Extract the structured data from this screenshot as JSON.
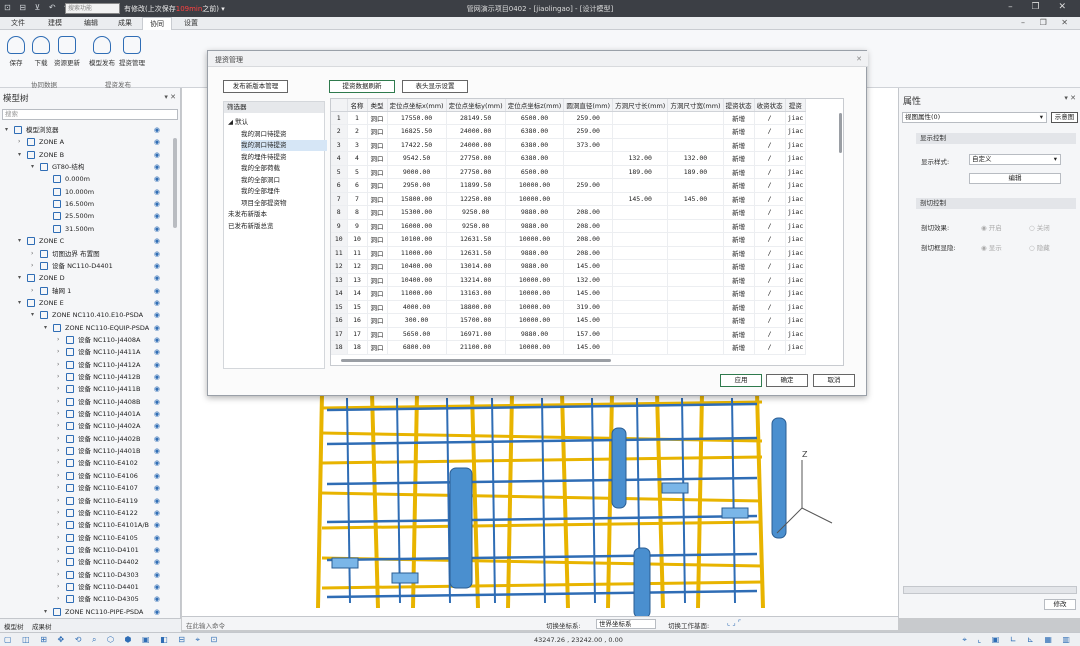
{
  "titlebar": {
    "quick_icons": "⊡ ⊟ ⊻ ↶ ↷",
    "search_placeholder": "搜索功能",
    "status_prefix": "有修改(上次保存",
    "status_highlight": "109min",
    "status_suffix": "之前)",
    "window_title": "管网演示项目0402 - [jiaolingao] - [设计模型]",
    "window_controls": "– ❐ ✕"
  },
  "menu": {
    "tabs": [
      "文件",
      "建模",
      "编辑",
      "成果",
      "协同",
      "设置"
    ],
    "active_index": 4,
    "right_controls": "– ❐ ✕"
  },
  "ribbon": {
    "buttons": [
      "保存",
      "下载",
      "资源更新",
      "模型发布",
      "提资管理"
    ],
    "groups": [
      "协同数据",
      "提资发布"
    ]
  },
  "model_tree": {
    "title": "模型树",
    "search_placeholder": "搜索",
    "rows": [
      {
        "label": "模型浏览器",
        "level": 0,
        "expanded": true,
        "icon": "folder-icon"
      },
      {
        "label": "ZONE A",
        "level": 1,
        "expanded": false,
        "icon": "folder-icon"
      },
      {
        "label": "ZONE B",
        "level": 1,
        "expanded": true,
        "icon": "folder-icon"
      },
      {
        "label": "GT80-结构",
        "level": 2,
        "expanded": true,
        "icon": "structure-icon"
      },
      {
        "label": "0.000m",
        "level": 3,
        "icon": "grid-icon"
      },
      {
        "label": "10.000m",
        "level": 3,
        "icon": "grid-icon"
      },
      {
        "label": "16.500m",
        "level": 3,
        "icon": "grid-icon"
      },
      {
        "label": "25.500m",
        "level": 3,
        "icon": "grid-icon"
      },
      {
        "label": "31.500m",
        "level": 3,
        "icon": "grid-icon"
      },
      {
        "label": "ZONE C",
        "level": 1,
        "expanded": true,
        "icon": "folder-icon"
      },
      {
        "label": "切图边界 布置图",
        "level": 2,
        "expanded": false,
        "icon": "drawing-icon"
      },
      {
        "label": "设备 NC110-D4401",
        "level": 2,
        "expanded": false,
        "icon": "equipment-icon"
      },
      {
        "label": "ZONE D",
        "level": 1,
        "expanded": true,
        "icon": "folder-icon"
      },
      {
        "label": "轴网 1",
        "level": 2,
        "expanded": false,
        "icon": "axis-icon"
      },
      {
        "label": "ZONE E",
        "level": 1,
        "expanded": true,
        "icon": "folder-icon"
      },
      {
        "label": "ZONE NC110.410.E10-PSDA",
        "level": 2,
        "expanded": true,
        "icon": "folder-icon"
      },
      {
        "label": "ZONE NC110-EQUIP-PSDA",
        "level": 3,
        "expanded": true,
        "icon": "folder-icon"
      },
      {
        "label": "设备 NC110-J4408A",
        "level": 4,
        "icon": "equipment-icon"
      },
      {
        "label": "设备 NC110-J4411A",
        "level": 4,
        "icon": "equipment-icon"
      },
      {
        "label": "设备 NC110-J4412A",
        "level": 4,
        "icon": "equipment-icon"
      },
      {
        "label": "设备 NC110-J4412B",
        "level": 4,
        "icon": "equipment-icon"
      },
      {
        "label": "设备 NC110-J4411B",
        "level": 4,
        "icon": "equipment-icon"
      },
      {
        "label": "设备 NC110-J4408B",
        "level": 4,
        "icon": "equipment-icon"
      },
      {
        "label": "设备 NC110-J4401A",
        "level": 4,
        "icon": "equipment-icon"
      },
      {
        "label": "设备 NC110-J4402A",
        "level": 4,
        "icon": "equipment-icon"
      },
      {
        "label": "设备 NC110-J4402B",
        "level": 4,
        "icon": "equipment-icon"
      },
      {
        "label": "设备 NC110-J4401B",
        "level": 4,
        "icon": "equipment-icon"
      },
      {
        "label": "设备 NC110-E4102",
        "level": 4,
        "icon": "equipment-icon"
      },
      {
        "label": "设备 NC110-E4106",
        "level": 4,
        "icon": "equipment-icon"
      },
      {
        "label": "设备 NC110-E4107",
        "level": 4,
        "icon": "equipment-icon"
      },
      {
        "label": "设备 NC110-E4119",
        "level": 4,
        "icon": "equipment-icon"
      },
      {
        "label": "设备 NC110-E4122",
        "level": 4,
        "icon": "equipment-icon"
      },
      {
        "label": "设备 NC110-E4101A/B",
        "level": 4,
        "icon": "equipment-icon"
      },
      {
        "label": "设备 NC110-E4105",
        "level": 4,
        "icon": "equipment-icon"
      },
      {
        "label": "设备 NC110-D4101",
        "level": 4,
        "icon": "equipment-icon"
      },
      {
        "label": "设备 NC110-D4402",
        "level": 4,
        "icon": "equipment-icon"
      },
      {
        "label": "设备 NC110-D4303",
        "level": 4,
        "icon": "equipment-icon"
      },
      {
        "label": "设备 NC110-D4401",
        "level": 4,
        "icon": "equipment-icon"
      },
      {
        "label": "设备 NC110-D4305",
        "level": 4,
        "icon": "equipment-icon"
      },
      {
        "label": "ZONE NC110-PIPE-PSDA",
        "level": 3,
        "expanded": true,
        "icon": "folder-icon"
      }
    ],
    "bottom_tabs": [
      "模型树",
      "成果树"
    ]
  },
  "properties": {
    "title": "属性",
    "view_select": "视图属性(0)",
    "select_button": "示意图",
    "section_display": "显示控制",
    "display_style_label": "显示样式:",
    "display_style_value": "自定义",
    "edit_button": "编辑",
    "section_cut": "剖切控制",
    "cut_effect_label": "剖切效果:",
    "cut_effect_options": [
      "开启",
      "关闭"
    ],
    "cut_hide_label": "剖切框显隐:",
    "cut_hide_options": [
      "显示",
      "隐藏"
    ],
    "modify_button": "修改"
  },
  "dialog": {
    "title": "提资管理",
    "btn_new_version": "发布新版本管理",
    "btn_refresh": "提资数据刷新",
    "btn_header_settings": "表头显示设置",
    "filter_title": "筛选器",
    "filter_items": [
      {
        "label": "默认",
        "level": 0,
        "expanded": true
      },
      {
        "label": "我的洞口待提资",
        "level": 1
      },
      {
        "label": "我的洞口待提资",
        "level": 1,
        "selected": true
      },
      {
        "label": "我的埋件待提资",
        "level": 1
      },
      {
        "label": "我的全部荷载",
        "level": 1
      },
      {
        "label": "我的全部洞口",
        "level": 1
      },
      {
        "label": "我的全部埋件",
        "level": 1
      },
      {
        "label": "项目全部提资物",
        "level": 1
      },
      {
        "label": "未发布新版本",
        "level": 0
      },
      {
        "label": "已发布新版总览",
        "level": 0
      }
    ],
    "columns": [
      "名称",
      "类型",
      "定位点坐标x(mm)",
      "定位点坐标y(mm)",
      "定位点坐标z(mm)",
      "圆洞直径(mm)",
      "方洞尺寸长(mm)",
      "方洞尺寸宽(mm)",
      "提资状态",
      "收资状态",
      "提资"
    ],
    "rows": [
      [
        "1",
        "洞口",
        "17550.00",
        "28149.50",
        "6500.00",
        "259.00",
        "",
        "",
        "新增",
        "/",
        "jiac"
      ],
      [
        "2",
        "洞口",
        "16825.50",
        "24000.00",
        "6380.00",
        "259.00",
        "",
        "",
        "新增",
        "/",
        "jiac"
      ],
      [
        "3",
        "洞口",
        "17422.50",
        "24000.00",
        "6380.00",
        "373.00",
        "",
        "",
        "新增",
        "/",
        "jiac"
      ],
      [
        "4",
        "洞口",
        "9542.50",
        "27750.00",
        "6380.00",
        "",
        "132.00",
        "132.00",
        "新增",
        "/",
        "jiac"
      ],
      [
        "5",
        "洞口",
        "9000.00",
        "27750.00",
        "6500.00",
        "",
        "189.00",
        "189.00",
        "新增",
        "/",
        "jiac"
      ],
      [
        "6",
        "洞口",
        "2950.00",
        "11899.50",
        "10000.00",
        "259.00",
        "",
        "",
        "新增",
        "/",
        "jiac"
      ],
      [
        "7",
        "洞口",
        "15800.00",
        "12250.00",
        "10000.00",
        "",
        "145.00",
        "145.00",
        "新增",
        "/",
        "jiac"
      ],
      [
        "8",
        "洞口",
        "15300.00",
        "9250.00",
        "9880.00",
        "208.00",
        "",
        "",
        "新增",
        "/",
        "jiac"
      ],
      [
        "9",
        "洞口",
        "16000.00",
        "9250.00",
        "9880.00",
        "208.00",
        "",
        "",
        "新增",
        "/",
        "jiac"
      ],
      [
        "10",
        "洞口",
        "10100.00",
        "12631.50",
        "10000.00",
        "208.00",
        "",
        "",
        "新增",
        "/",
        "jiac"
      ],
      [
        "11",
        "洞口",
        "11000.00",
        "12631.50",
        "9880.00",
        "208.00",
        "",
        "",
        "新增",
        "/",
        "jiac"
      ],
      [
        "12",
        "洞口",
        "10400.00",
        "13014.00",
        "9880.00",
        "145.00",
        "",
        "",
        "新增",
        "/",
        "jiac"
      ],
      [
        "13",
        "洞口",
        "10400.00",
        "13214.00",
        "10000.00",
        "132.00",
        "",
        "",
        "新增",
        "/",
        "jiac"
      ],
      [
        "14",
        "洞口",
        "11000.00",
        "13163.00",
        "10000.00",
        "145.00",
        "",
        "",
        "新增",
        "/",
        "jiac"
      ],
      [
        "15",
        "洞口",
        "4000.00",
        "18800.00",
        "10000.00",
        "319.00",
        "",
        "",
        "新增",
        "/",
        "jiac"
      ],
      [
        "16",
        "洞口",
        "300.00",
        "15700.00",
        "10000.00",
        "145.00",
        "",
        "",
        "新增",
        "/",
        "jiac"
      ],
      [
        "17",
        "洞口",
        "5650.00",
        "16971.00",
        "9880.00",
        "157.00",
        "",
        "",
        "新增",
        "/",
        "jiac"
      ],
      [
        "18",
        "洞口",
        "6800.00",
        "21100.00",
        "10000.00",
        "145.00",
        "",
        "",
        "新增",
        "/",
        "jiac"
      ]
    ],
    "btn_apply": "应用",
    "btn_ok": "确定",
    "btn_cancel": "取消"
  },
  "viewport": {
    "axis_z": "Z",
    "frame_color": "#e8b400",
    "pipe_color": "#2f6db5",
    "equipment_color": "#4a8fcf"
  },
  "command_bar": {
    "placeholder": "在此输入命令",
    "coord_switch_label": "切换坐标系:",
    "coord_value": "世界坐标系",
    "workplane_label": "切换工作基面:"
  },
  "status": {
    "coordinates": "43247.26 , 23242.00 , 0.00"
  }
}
